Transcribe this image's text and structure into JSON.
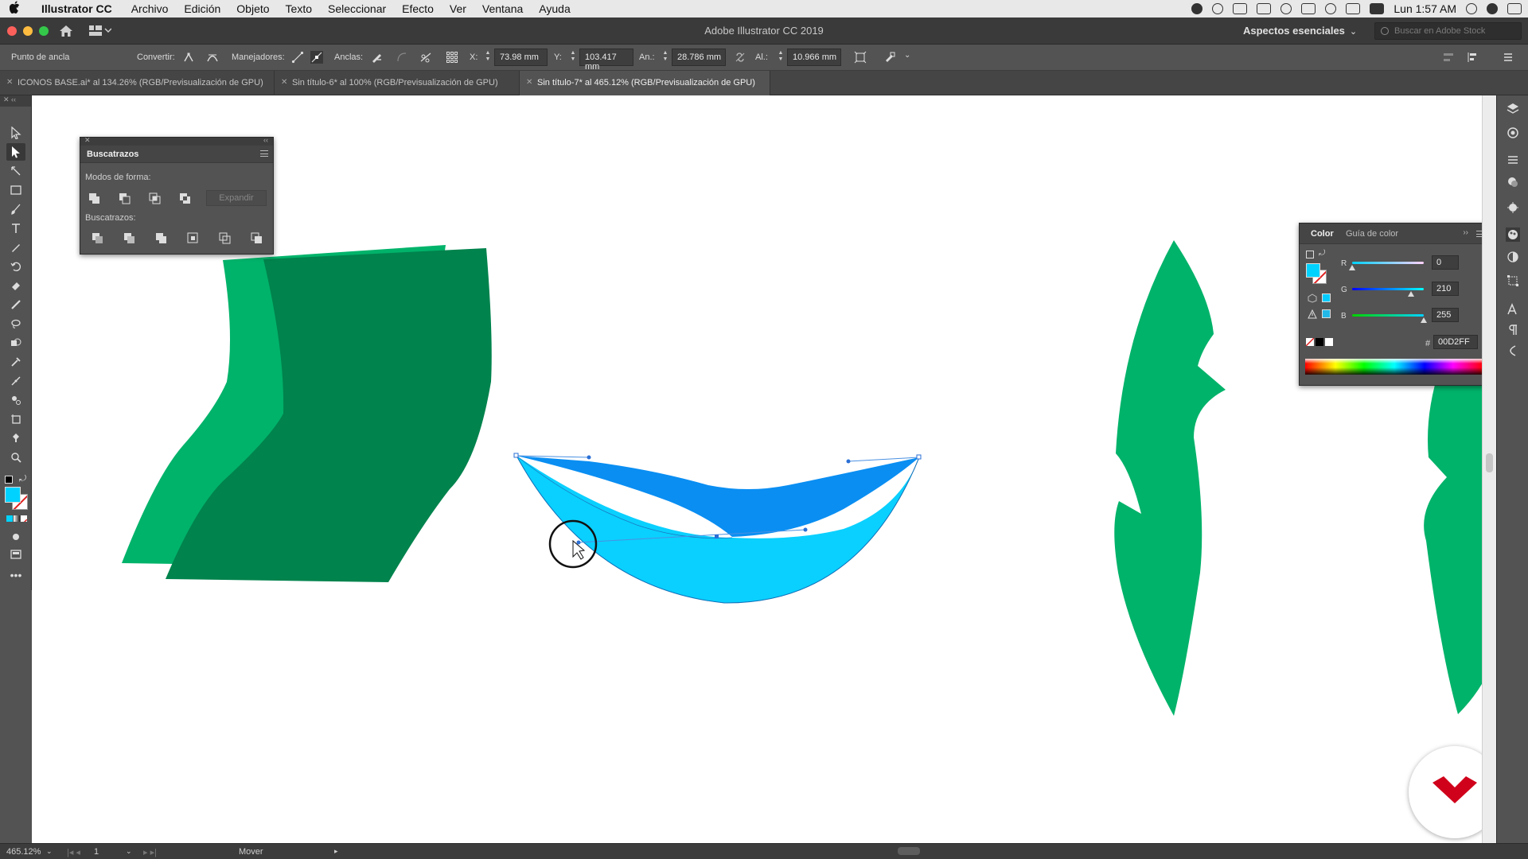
{
  "menubar": {
    "app_name": "Illustrator CC",
    "items": [
      "Archivo",
      "Edición",
      "Objeto",
      "Texto",
      "Seleccionar",
      "Efecto",
      "Ver",
      "Ventana",
      "Ayuda"
    ],
    "clock": "Lun 1:57 AM"
  },
  "window": {
    "title": "Adobe Illustrator CC 2019",
    "workspace": "Aspectos esenciales",
    "stock_search_placeholder": "Buscar en Adobe Stock"
  },
  "control_bar": {
    "selection_label": "Punto de ancla",
    "convert_label": "Convertir:",
    "handles_label": "Manejadores:",
    "anchors_label": "Anclas:",
    "x_label": "X:",
    "x_value": "73.98 mm",
    "y_label": "Y:",
    "y_value": "103.417 mm",
    "w_label": "An.:",
    "w_value": "28.786 mm",
    "h_label": "Al.:",
    "h_value": "10.966 mm"
  },
  "tabs": [
    {
      "label": "ICONOS BASE.ai* al 134.26% (RGB/Previsualización de GPU)",
      "active": false
    },
    {
      "label": "Sin título-6* al 100% (RGB/Previsualización de GPU)",
      "active": false
    },
    {
      "label": "Sin título-7* al 465.12% (RGB/Previsualización de GPU)",
      "active": true
    }
  ],
  "pathfinder": {
    "title": "Buscatrazos",
    "shape_modes_label": "Modos de forma:",
    "expand_label": "Expandir",
    "pathfinders_label": "Buscatrazos:"
  },
  "color_panel": {
    "tab_color": "Color",
    "tab_guide": "Guía de color",
    "r_label": "R",
    "r_value": "0",
    "g_label": "G",
    "g_value": "210",
    "b_label": "B",
    "b_value": "255",
    "hex_prefix": "#",
    "hex_value": "00D2FF",
    "fill_color": "#00D2FF"
  },
  "status_bar": {
    "zoom": "465.12%",
    "artboard_number": "1",
    "tool_status": "Mover"
  },
  "colors": {
    "leaf_green": "#00B36A",
    "dark_green": "#00834D",
    "sky_blue": "#0AD0FF",
    "deep_blue": "#0A8EF2",
    "accent_red": "#D0021B"
  }
}
